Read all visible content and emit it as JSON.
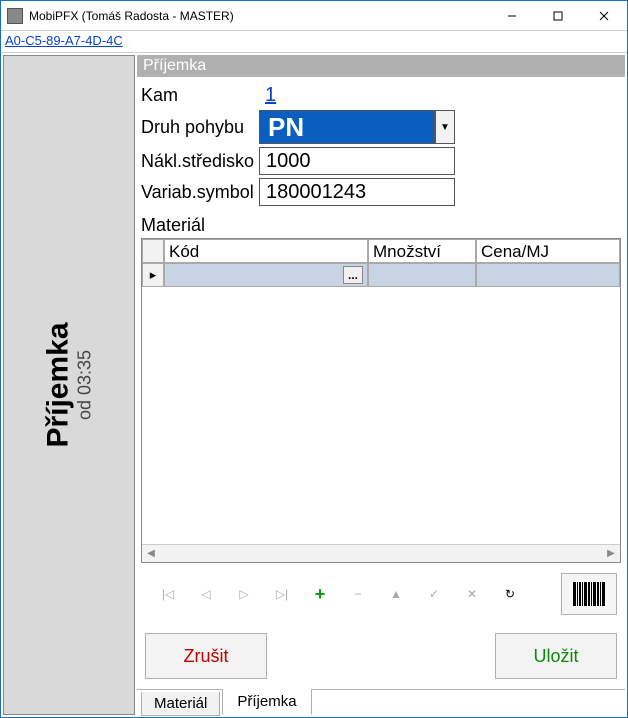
{
  "window": {
    "title": "MobiPFX (Tomáš Radosta - MASTER)"
  },
  "mac_address": "A0-C5-89-A7-4D-4C",
  "sidebar": {
    "title": "Příjemka",
    "subtitle": "od 03:35"
  },
  "section": {
    "title": "Příjemka"
  },
  "form": {
    "kam_label": "Kam",
    "kam_value": "1",
    "druh_label": "Druh pohybu",
    "druh_value": "PN",
    "stredisko_label": "Nákl.středisko",
    "stredisko_value": "1000",
    "variab_label": "Variab.symbol",
    "variab_value": "180001243"
  },
  "material": {
    "label": "Materiál",
    "columns": {
      "kod": "Kód",
      "mnozstvi": "Množství",
      "cena": "Cena/MJ"
    },
    "rows": [
      {
        "kod": "",
        "mnozstvi": "",
        "cena": ""
      }
    ],
    "ellipsis": "..."
  },
  "navigator": {
    "first": "|◁",
    "prev": "◁",
    "next": "▷",
    "last": "▷|",
    "insert": "+",
    "delete": "−",
    "edit": "▲",
    "post": "✓",
    "cancel": "✕",
    "refresh": "↻"
  },
  "actions": {
    "cancel": "Zrušit",
    "save": "Uložit"
  },
  "tabs": {
    "material": "Materiál",
    "prijemka": "Příjemka"
  }
}
